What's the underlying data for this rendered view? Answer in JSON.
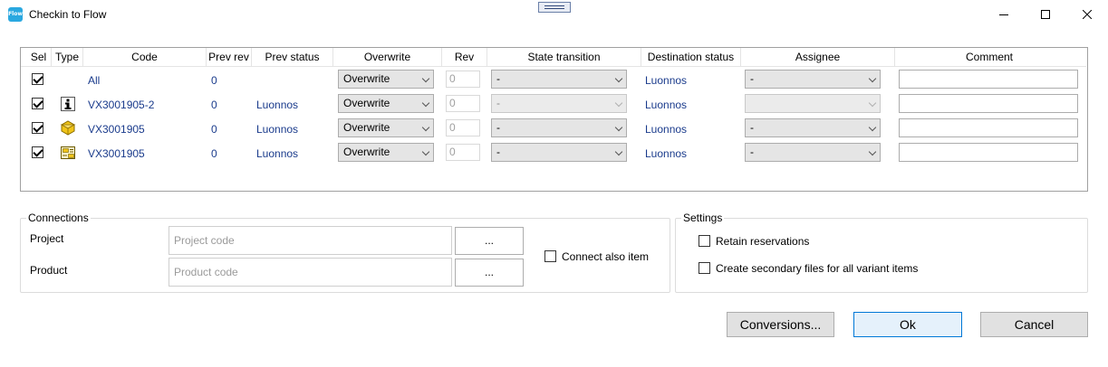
{
  "window": {
    "title": "Checkin to Flow",
    "app_icon_text": "Flow",
    "controls": {
      "minimize": "minimize-icon",
      "maximize": "maximize-icon",
      "close": "close-icon"
    }
  },
  "grid": {
    "columns": [
      "Sel",
      "Type",
      "Code",
      "Prev rev",
      "Prev status",
      "Overwrite",
      "Rev",
      "State transition",
      "Destination status",
      "Assignee",
      "Comment"
    ],
    "rows": [
      {
        "selected": true,
        "type_icon": "none",
        "code": "All",
        "prev_rev": "0",
        "prev_status": "",
        "overwrite": "Overwrite",
        "rev": "0",
        "state_transition": "-",
        "state_enabled": true,
        "destination_status": "Luonnos",
        "assignee": "-",
        "assignee_enabled": true,
        "comment": ""
      },
      {
        "selected": true,
        "type_icon": "info-icon",
        "code": "VX3001905-2",
        "prev_rev": "0",
        "prev_status": "Luonnos",
        "overwrite": "Overwrite",
        "rev": "0",
        "state_transition": "-",
        "state_enabled": false,
        "destination_status": "Luonnos",
        "assignee": "",
        "assignee_enabled": false,
        "comment": ""
      },
      {
        "selected": true,
        "type_icon": "assembly-icon",
        "code": "VX3001905",
        "prev_rev": "0",
        "prev_status": "Luonnos",
        "overwrite": "Overwrite",
        "rev": "0",
        "state_transition": "-",
        "state_enabled": true,
        "destination_status": "Luonnos",
        "assignee": "-",
        "assignee_enabled": true,
        "comment": ""
      },
      {
        "selected": true,
        "type_icon": "drawing-icon",
        "code": "VX3001905",
        "prev_rev": "0",
        "prev_status": "Luonnos",
        "overwrite": "Overwrite",
        "rev": "0",
        "state_transition": "-",
        "state_enabled": true,
        "destination_status": "Luonnos",
        "assignee": "-",
        "assignee_enabled": true,
        "comment": ""
      }
    ]
  },
  "connections": {
    "title": "Connections",
    "project_label": "Project",
    "project_placeholder": "Project code",
    "product_label": "Product",
    "product_placeholder": "Product code",
    "browse_label": "...",
    "connect_also_item_label": "Connect also item",
    "connect_also_item_checked": false
  },
  "settings": {
    "title": "Settings",
    "retain_reservations_label": "Retain reservations",
    "retain_reservations_checked": false,
    "create_secondary_label": "Create secondary files for all variant items",
    "create_secondary_checked": false
  },
  "buttons": {
    "conversions": "Conversions...",
    "ok": "Ok",
    "cancel": "Cancel"
  },
  "colors": {
    "link_text": "#1a3b8c",
    "ok_border": "#0078d7"
  }
}
